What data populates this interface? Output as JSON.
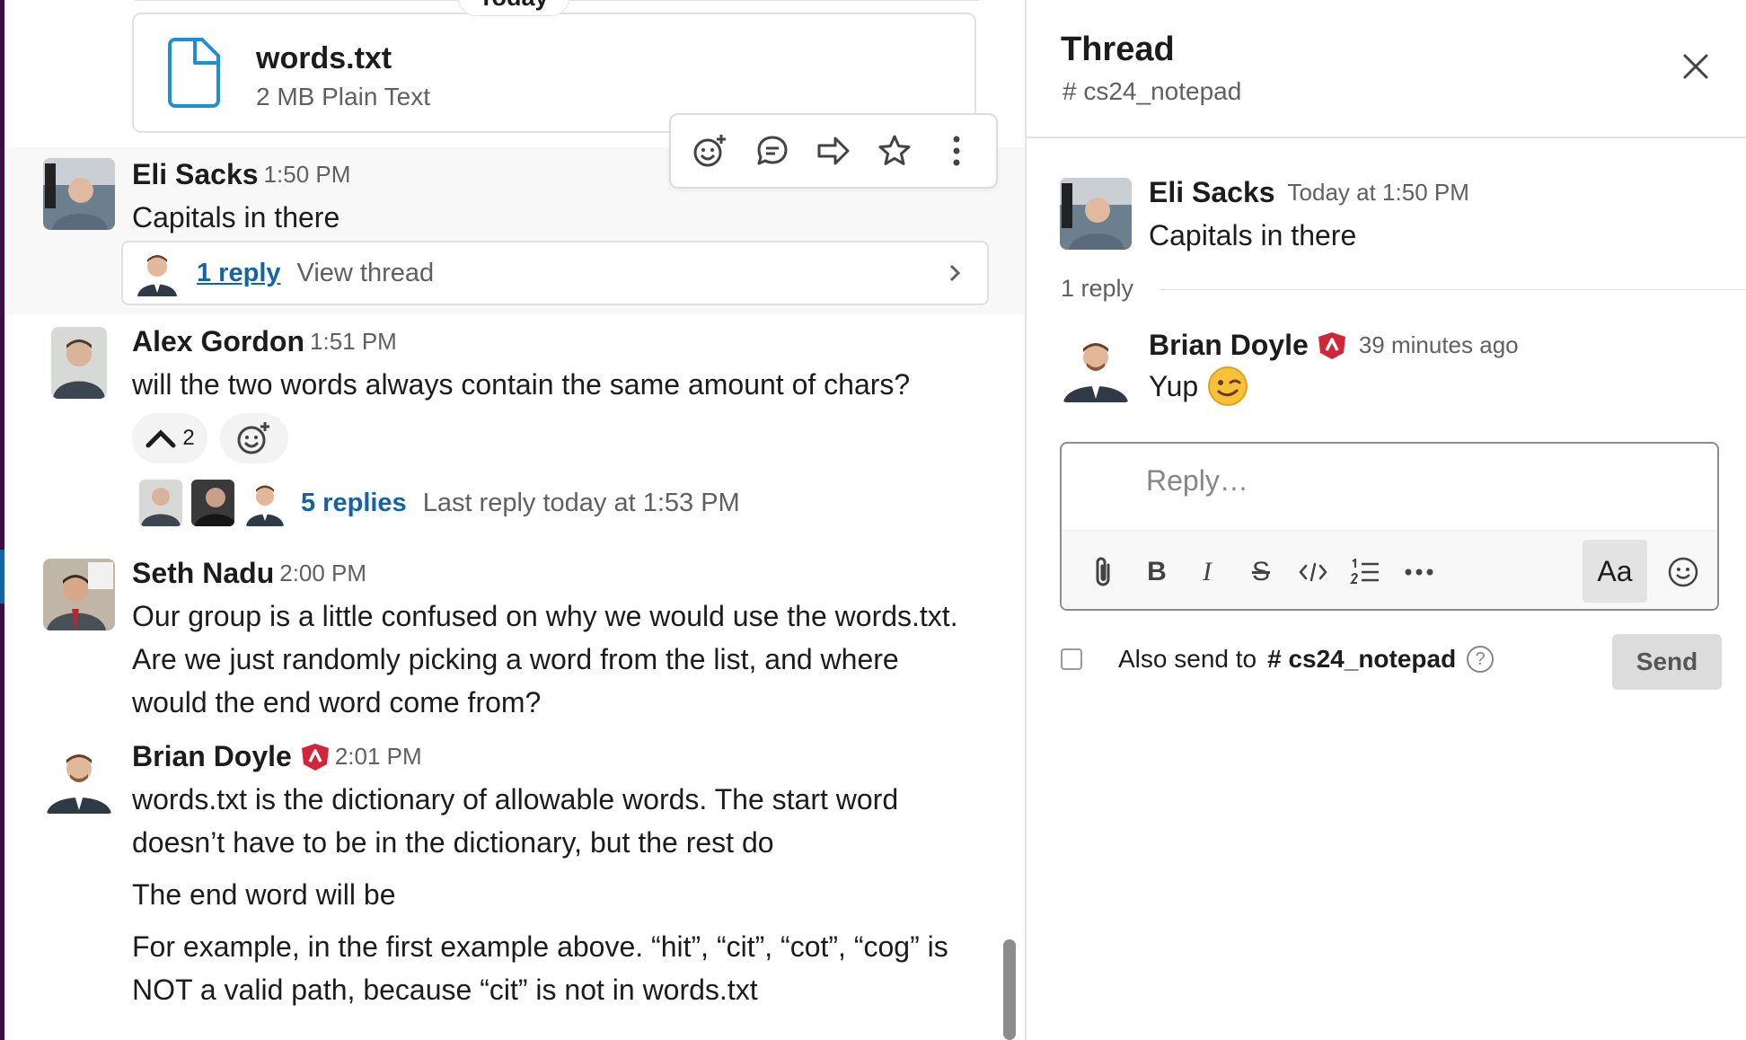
{
  "colors": {
    "link": "#1264a3",
    "badge": "#d1263a",
    "file_icon": "#1d8fd6"
  },
  "day_divider": {
    "label": "Today"
  },
  "file": {
    "name": "words.txt",
    "meta": "2 MB Plain Text"
  },
  "messages": [
    {
      "name": "Eli Sacks",
      "time": "1:50 PM",
      "text": [
        "Capitals in there"
      ],
      "thread": {
        "replies": "1 reply",
        "view": "View thread"
      }
    },
    {
      "name": "Alex Gordon",
      "time": "1:51 PM",
      "text": [
        "will the two words always contain the same amount of chars?"
      ],
      "reaction": {
        "emoji": "caret-up",
        "count": "2"
      },
      "replies": {
        "count": "5 replies",
        "last": "Last reply today at 1:53 PM"
      }
    },
    {
      "name": "Seth Nadu",
      "time": "2:00 PM",
      "text": [
        "Our group is a little confused on why we would use the words.txt.",
        "Are we just randomly picking a word from the list, and where",
        "would the end word come from?"
      ]
    },
    {
      "name": "Brian Doyle",
      "time": "2:01 PM",
      "text": [
        "words.txt is the dictionary of allowable words.   The start word",
        "doesn’t have to be in the dictionary, but the rest do",
        "The end word will be",
        "For example,  in the first example above.  “hit”, “cit”, “cot”, “cog” is",
        "NOT a valid path,  because “cit” is not in words.txt"
      ]
    }
  ],
  "thread": {
    "title": "Thread",
    "channel": "# cs24_notepad",
    "parent": {
      "name": "Eli Sacks",
      "time": "Today at 1:50 PM",
      "text": "Capitals in there"
    },
    "reply_count": "1 reply",
    "reply": {
      "name": "Brian Doyle",
      "time": "39 minutes ago",
      "text": "Yup",
      "emoji": "winking-face"
    },
    "composer": {
      "placeholder": "Reply…",
      "aa": "Aa"
    },
    "also_send": {
      "label": "Also send to",
      "channel": "# cs24_notepad",
      "help": "?"
    },
    "send_label": "Send"
  }
}
